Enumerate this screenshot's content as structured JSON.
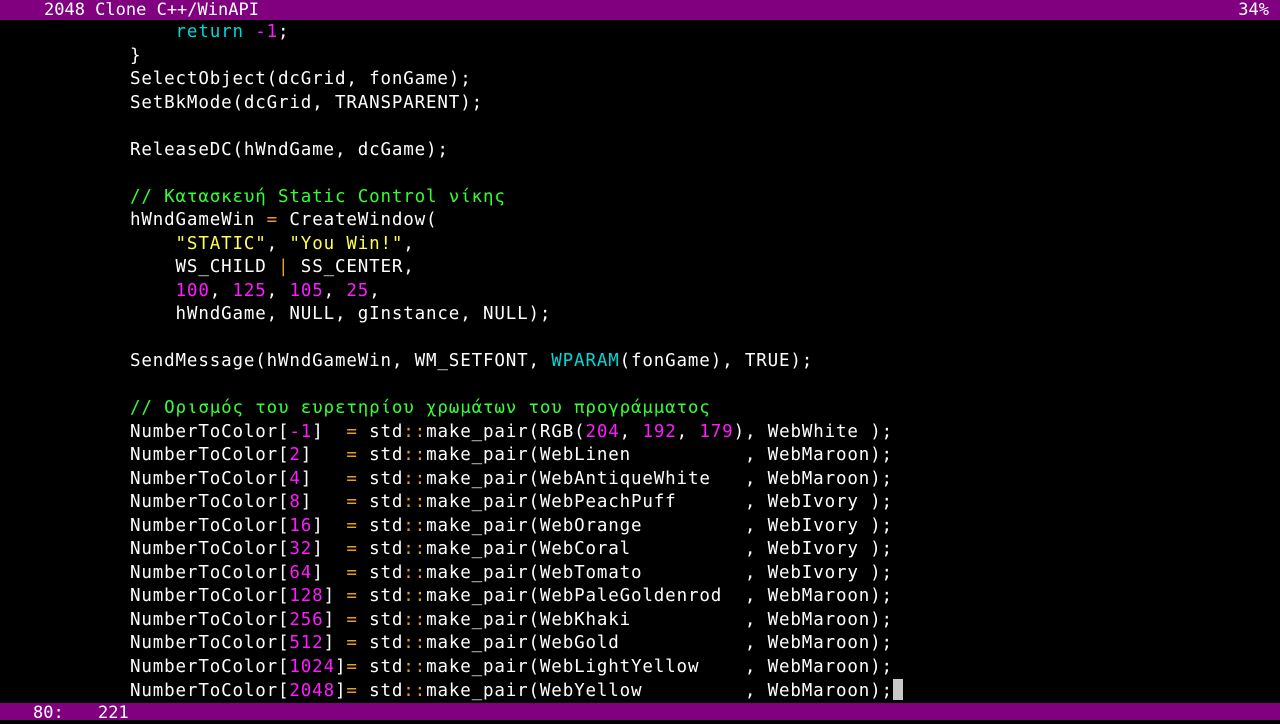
{
  "header": {
    "title": "2048 Clone C++/WinAPI",
    "percent": "34%"
  },
  "status": {
    "line": "80:",
    "col": "221"
  },
  "colors": {
    "bar": "#800080",
    "keyword": "#00d7d7",
    "number": "#ff1aff",
    "string": "#ffff4d",
    "comment": "#33ff33",
    "operator": "#e6a020"
  },
  "code": {
    "lines": [
      {
        "indent": 4,
        "tokens": [
          {
            "t": "return",
            "c": "kw"
          },
          {
            "t": " "
          },
          {
            "t": "-1",
            "c": "num"
          },
          {
            "t": ";"
          }
        ]
      },
      {
        "indent": 0,
        "tokens": [
          {
            "t": "}"
          }
        ]
      },
      {
        "indent": 0,
        "tokens": [
          {
            "t": "SelectObject(dcGrid, fonGame);"
          }
        ]
      },
      {
        "indent": 0,
        "tokens": [
          {
            "t": "SetBkMode(dcGrid, TRANSPARENT);"
          }
        ]
      },
      {
        "indent": 0,
        "tokens": []
      },
      {
        "indent": 0,
        "tokens": [
          {
            "t": "ReleaseDC(hWndGame, dcGame);"
          }
        ]
      },
      {
        "indent": 0,
        "tokens": []
      },
      {
        "indent": 0,
        "tokens": [
          {
            "t": "// Κατασκευή Static Control νίκης",
            "c": "cm"
          }
        ]
      },
      {
        "indent": 0,
        "tokens": [
          {
            "t": "hWndGameWin "
          },
          {
            "t": "=",
            "c": "op"
          },
          {
            "t": " CreateWindow("
          }
        ]
      },
      {
        "indent": 4,
        "tokens": [
          {
            "t": "\"STATIC\"",
            "c": "str"
          },
          {
            "t": ", "
          },
          {
            "t": "\"You Win!\"",
            "c": "str"
          },
          {
            "t": ","
          }
        ]
      },
      {
        "indent": 4,
        "tokens": [
          {
            "t": "WS_CHILD "
          },
          {
            "t": "|",
            "c": "op"
          },
          {
            "t": " SS_CENTER,"
          }
        ]
      },
      {
        "indent": 4,
        "tokens": [
          {
            "t": "100",
            "c": "num"
          },
          {
            "t": ", "
          },
          {
            "t": "125",
            "c": "num"
          },
          {
            "t": ", "
          },
          {
            "t": "105",
            "c": "num"
          },
          {
            "t": ", "
          },
          {
            "t": "25",
            "c": "num"
          },
          {
            "t": ","
          }
        ]
      },
      {
        "indent": 4,
        "tokens": [
          {
            "t": "hWndGame, NULL, gInstance, NULL);"
          }
        ]
      },
      {
        "indent": 0,
        "tokens": []
      },
      {
        "indent": 0,
        "tokens": [
          {
            "t": "SendMessage(hWndGameWin, WM_SETFONT, "
          },
          {
            "t": "WPARAM",
            "c": "type"
          },
          {
            "t": "(fonGame), TRUE);"
          }
        ]
      },
      {
        "indent": 0,
        "tokens": []
      },
      {
        "indent": 0,
        "tokens": [
          {
            "t": "// Ορισμός του ευρετηρίου χρωμάτων του προγράμματος",
            "c": "cm"
          }
        ]
      },
      {
        "indent": 0,
        "tokens": [
          {
            "t": "NumberToColor["
          },
          {
            "t": "-1",
            "c": "num"
          },
          {
            "t": "]  "
          },
          {
            "t": "=",
            "c": "op"
          },
          {
            "t": " std"
          },
          {
            "t": "::",
            "c": "op"
          },
          {
            "t": "make_pair(RGB("
          },
          {
            "t": "204",
            "c": "num"
          },
          {
            "t": ", "
          },
          {
            "t": "192",
            "c": "num"
          },
          {
            "t": ", "
          },
          {
            "t": "179",
            "c": "num"
          },
          {
            "t": "), WebWhite );"
          }
        ]
      },
      {
        "indent": 0,
        "tokens": [
          {
            "t": "NumberToColor["
          },
          {
            "t": "2",
            "c": "num"
          },
          {
            "t": "]   "
          },
          {
            "t": "=",
            "c": "op"
          },
          {
            "t": " std"
          },
          {
            "t": "::",
            "c": "op"
          },
          {
            "t": "make_pair(WebLinen          , WebMaroon);"
          }
        ]
      },
      {
        "indent": 0,
        "tokens": [
          {
            "t": "NumberToColor["
          },
          {
            "t": "4",
            "c": "num"
          },
          {
            "t": "]   "
          },
          {
            "t": "=",
            "c": "op"
          },
          {
            "t": " std"
          },
          {
            "t": "::",
            "c": "op"
          },
          {
            "t": "make_pair(WebAntiqueWhite   , WebMaroon);"
          }
        ]
      },
      {
        "indent": 0,
        "tokens": [
          {
            "t": "NumberToColor["
          },
          {
            "t": "8",
            "c": "num"
          },
          {
            "t": "]   "
          },
          {
            "t": "=",
            "c": "op"
          },
          {
            "t": " std"
          },
          {
            "t": "::",
            "c": "op"
          },
          {
            "t": "make_pair(WebPeachPuff      , WebIvory );"
          }
        ]
      },
      {
        "indent": 0,
        "tokens": [
          {
            "t": "NumberToColor["
          },
          {
            "t": "16",
            "c": "num"
          },
          {
            "t": "]  "
          },
          {
            "t": "=",
            "c": "op"
          },
          {
            "t": " std"
          },
          {
            "t": "::",
            "c": "op"
          },
          {
            "t": "make_pair(WebOrange         , WebIvory );"
          }
        ]
      },
      {
        "indent": 0,
        "tokens": [
          {
            "t": "NumberToColor["
          },
          {
            "t": "32",
            "c": "num"
          },
          {
            "t": "]  "
          },
          {
            "t": "=",
            "c": "op"
          },
          {
            "t": " std"
          },
          {
            "t": "::",
            "c": "op"
          },
          {
            "t": "make_pair(WebCoral          , WebIvory );"
          }
        ]
      },
      {
        "indent": 0,
        "tokens": [
          {
            "t": "NumberToColor["
          },
          {
            "t": "64",
            "c": "num"
          },
          {
            "t": "]  "
          },
          {
            "t": "=",
            "c": "op"
          },
          {
            "t": " std"
          },
          {
            "t": "::",
            "c": "op"
          },
          {
            "t": "make_pair(WebTomato         , WebIvory );"
          }
        ]
      },
      {
        "indent": 0,
        "tokens": [
          {
            "t": "NumberToColor["
          },
          {
            "t": "128",
            "c": "num"
          },
          {
            "t": "] "
          },
          {
            "t": "=",
            "c": "op"
          },
          {
            "t": " std"
          },
          {
            "t": "::",
            "c": "op"
          },
          {
            "t": "make_pair(WebPaleGoldenrod  , WebMaroon);"
          }
        ]
      },
      {
        "indent": 0,
        "tokens": [
          {
            "t": "NumberToColor["
          },
          {
            "t": "256",
            "c": "num"
          },
          {
            "t": "] "
          },
          {
            "t": "=",
            "c": "op"
          },
          {
            "t": " std"
          },
          {
            "t": "::",
            "c": "op"
          },
          {
            "t": "make_pair(WebKhaki          , WebMaroon);"
          }
        ]
      },
      {
        "indent": 0,
        "tokens": [
          {
            "t": "NumberToColor["
          },
          {
            "t": "512",
            "c": "num"
          },
          {
            "t": "] "
          },
          {
            "t": "=",
            "c": "op"
          },
          {
            "t": " std"
          },
          {
            "t": "::",
            "c": "op"
          },
          {
            "t": "make_pair(WebGold           , WebMaroon);"
          }
        ]
      },
      {
        "indent": 0,
        "tokens": [
          {
            "t": "NumberToColor["
          },
          {
            "t": "1024",
            "c": "num"
          },
          {
            "t": "]"
          },
          {
            "t": "=",
            "c": "op"
          },
          {
            "t": " std"
          },
          {
            "t": "::",
            "c": "op"
          },
          {
            "t": "make_pair(WebLightYellow    , WebMaroon);"
          }
        ]
      },
      {
        "indent": 0,
        "cursor": true,
        "tokens": [
          {
            "t": "NumberToColor["
          },
          {
            "t": "2048",
            "c": "num"
          },
          {
            "t": "]"
          },
          {
            "t": "=",
            "c": "op"
          },
          {
            "t": " std"
          },
          {
            "t": "::",
            "c": "op"
          },
          {
            "t": "make_pair(WebYellow         , WebMaroon);"
          }
        ]
      }
    ]
  }
}
